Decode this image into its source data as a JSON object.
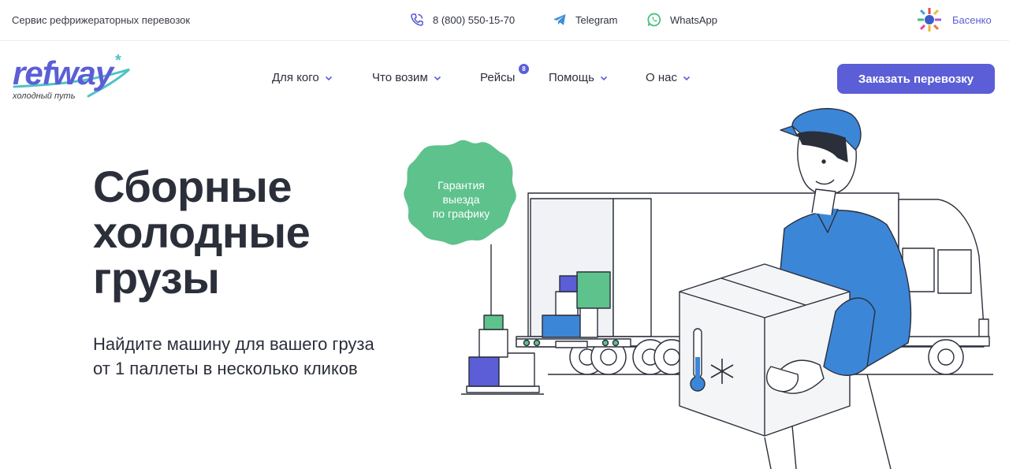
{
  "topbar": {
    "service_title": "Сервис рефрижераторных перевозок",
    "phone": "8 (800) 550-15-70",
    "telegram": "Telegram",
    "whatsapp": "WhatsApp",
    "user_name": "Басенко"
  },
  "logo": {
    "word": "refway",
    "tagline": "холодный путь"
  },
  "nav": {
    "items": [
      {
        "label": "Для кого",
        "has_dropdown": true
      },
      {
        "label": "Что возим",
        "has_dropdown": true
      },
      {
        "label": "Рейсы",
        "has_dropdown": false,
        "badge": "8"
      },
      {
        "label": "Помощь",
        "has_dropdown": true
      },
      {
        "label": "О нас",
        "has_dropdown": true
      }
    ],
    "cta_label": "Заказать перевозку"
  },
  "hero": {
    "title_lines": [
      "Сборные",
      "холодные",
      "грузы"
    ],
    "subtitle": "Найдите машину для вашего груза от 1 паллеты в несколько кликов",
    "sticker_lines": [
      "Гарантия",
      "выезда",
      "по графику"
    ]
  },
  "colors": {
    "accent": "#5b5ed6",
    "sticker": "#5ec28c",
    "worker_shirt": "#3c86d8",
    "text": "#2b2f3a"
  },
  "icons": [
    "phone-icon",
    "telegram-icon",
    "whatsapp-icon",
    "chevron-down-icon",
    "thermometer-icon",
    "snowflake-icon"
  ]
}
